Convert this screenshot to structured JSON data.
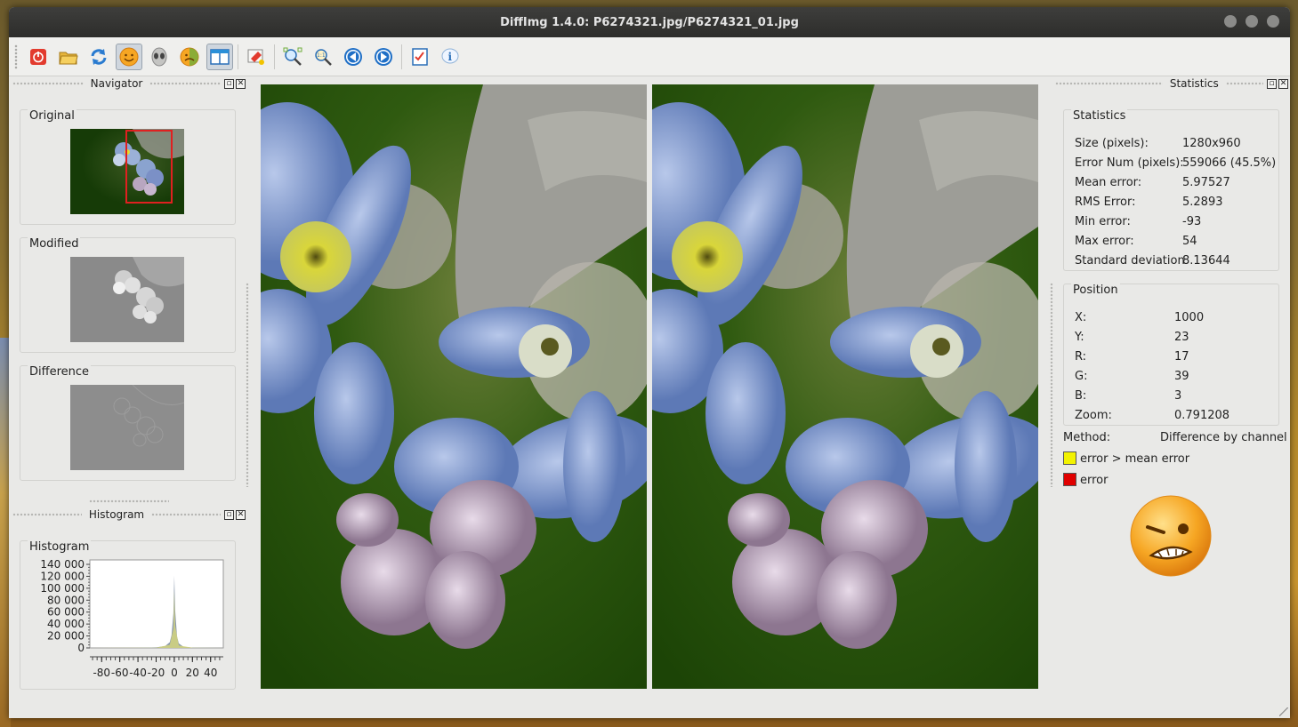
{
  "window": {
    "title": "DiffImg 1.4.0: P6274321.jpg/P6274321_01.jpg"
  },
  "toolbar": {
    "buttons": [
      "quit-icon",
      "open-folder-icon",
      "refresh-icon",
      "happy-face-icon",
      "alien-face-icon",
      "sad-face-icon",
      "dual-panel-icon",
      "highlight-icon",
      "zoom-fit-icon",
      "zoom-100-icon",
      "previous-icon",
      "next-icon",
      "checklist-icon",
      "info-icon"
    ]
  },
  "navigator": {
    "title": "Navigator",
    "original_label": "Original",
    "modified_label": "Modified",
    "difference_label": "Difference"
  },
  "histogram_dock": {
    "title": "Histogram",
    "group_label": "Histogram",
    "chart_data": {
      "type": "area",
      "y_ticks": [
        "140 000",
        "120 000",
        "100 000",
        "80 000",
        "60 000",
        "40 000",
        "20 000",
        "0"
      ],
      "x_ticks": [
        "-80",
        "-60",
        "-40",
        "-20",
        "0",
        "20",
        "40"
      ],
      "ylim": [
        0,
        140000
      ],
      "xlim": [
        -93,
        54
      ],
      "series": [
        {
          "points": [
            [
              -93,
              0
            ],
            [
              -40,
              200
            ],
            [
              -20,
              800
            ],
            [
              -10,
              3000
            ],
            [
              -5,
              9000
            ],
            [
              -3,
              20000
            ],
            [
              -1,
              55000
            ],
            [
              0,
              115000
            ],
            [
              1,
              60000
            ],
            [
              3,
              18000
            ],
            [
              5,
              7000
            ],
            [
              10,
              2000
            ],
            [
              20,
              500
            ],
            [
              40,
              100
            ],
            [
              54,
              0
            ]
          ],
          "color": "#7f8fa6"
        },
        {
          "points": [
            [
              -93,
              0
            ],
            [
              -20,
              400
            ],
            [
              -5,
              5000
            ],
            [
              -1,
              30000
            ],
            [
              0,
              92000
            ],
            [
              1,
              35000
            ],
            [
              5,
              4000
            ],
            [
              20,
              300
            ],
            [
              54,
              0
            ]
          ],
          "color": "#d8d87a"
        }
      ]
    }
  },
  "statistics_dock": {
    "title": "Statistics",
    "stats_group": "Statistics",
    "stats": [
      {
        "label": "Size (pixels):",
        "value": "1280x960"
      },
      {
        "label": "Error Num (pixels):",
        "value": "559066 (45.5%)"
      },
      {
        "label": "Mean error:",
        "value": "5.97527"
      },
      {
        "label": "RMS Error:",
        "value": "5.2893"
      },
      {
        "label": "Min error:",
        "value": "-93"
      },
      {
        "label": "Max error:",
        "value": "54"
      },
      {
        "label": "Standard deviation",
        "value": "8.13644"
      }
    ],
    "position_group": "Position",
    "position": [
      {
        "label": "X:",
        "value": "1000"
      },
      {
        "label": "Y:",
        "value": "23"
      },
      {
        "label": "R:",
        "value": "17"
      },
      {
        "label": "G:",
        "value": "39"
      },
      {
        "label": "B:",
        "value": "3"
      },
      {
        "label": "Zoom:",
        "value": "0.791208"
      }
    ],
    "method_label": "Method:",
    "method_value": "Difference by channel",
    "legend": [
      {
        "label": "error > mean error",
        "color": "#f2f200"
      },
      {
        "label": "error",
        "color": "#e00000"
      }
    ]
  },
  "colors": {
    "accent_red": "#e23b2e",
    "panel_bg": "#e9e9e7",
    "titlebar": "#2f2f2d"
  }
}
